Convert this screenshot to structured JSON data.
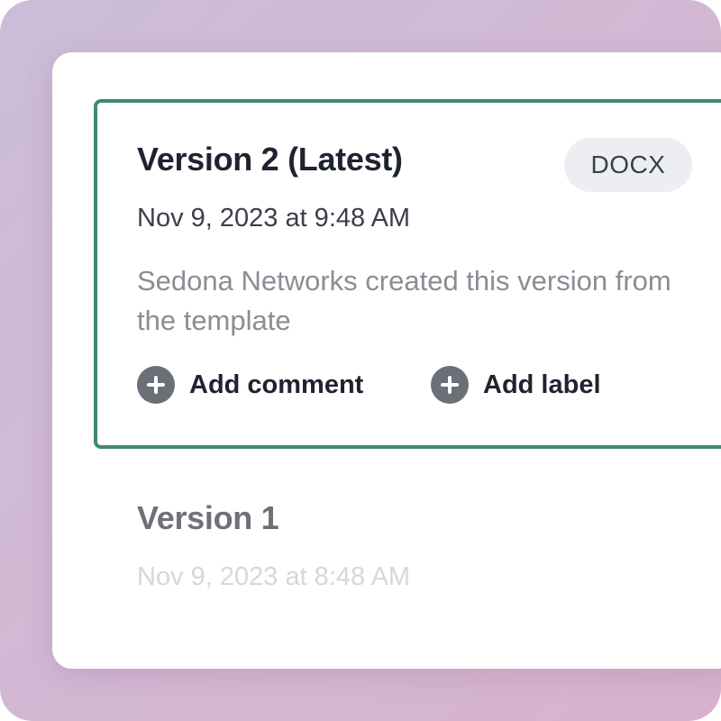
{
  "versions": [
    {
      "title": "Version 2 (Latest)",
      "format": "DOCX",
      "date": "Nov 9, 2023 at 9:48 AM",
      "description": "Sedona Networks created this version from the template",
      "actions": {
        "comment": "Add comment",
        "label": "Add label"
      },
      "selected": true
    },
    {
      "title": "Version 1",
      "date": "Nov 9, 2023 at 8:48 AM"
    }
  ],
  "colors": {
    "selected_border": "#3e8a72",
    "badge_bg": "#eceef2",
    "icon_bg": "#6b6f78"
  },
  "icons": [
    "plus-circle-icon",
    "plus-circle-icon"
  ]
}
